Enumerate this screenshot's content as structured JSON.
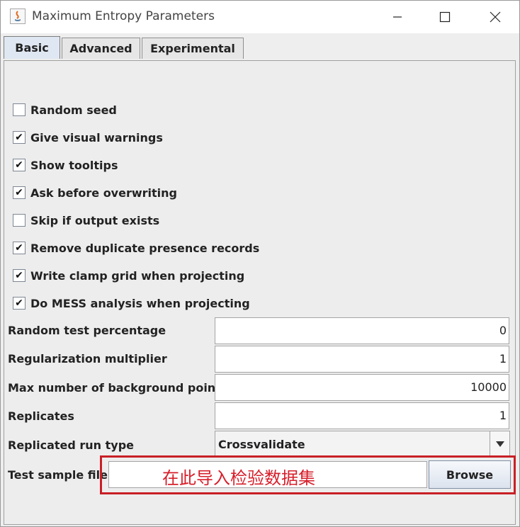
{
  "window": {
    "title": "Maximum Entropy Parameters"
  },
  "tabs": [
    {
      "label": "Basic",
      "active": true
    },
    {
      "label": "Advanced",
      "active": false
    },
    {
      "label": "Experimental",
      "active": false
    }
  ],
  "options": [
    {
      "label": "Random seed",
      "checked": false
    },
    {
      "label": "Give visual warnings",
      "checked": true
    },
    {
      "label": "Show tooltips",
      "checked": true
    },
    {
      "label": "Ask before overwriting",
      "checked": true
    },
    {
      "label": "Skip if output exists",
      "checked": false
    },
    {
      "label": "Remove duplicate presence records",
      "checked": true
    },
    {
      "label": "Write clamp grid when projecting",
      "checked": true
    },
    {
      "label": "Do MESS analysis when projecting",
      "checked": true
    }
  ],
  "fields": [
    {
      "label": "Random test percentage",
      "value": "0"
    },
    {
      "label": "Regularization multiplier",
      "value": "1"
    },
    {
      "label": "Max number of background points",
      "value": "10000"
    },
    {
      "label": "Replicates",
      "value": "1"
    }
  ],
  "run_type": {
    "label": "Replicated run type",
    "selected": "Crossvalidate"
  },
  "test_sample": {
    "label": "Test sample file",
    "value": "",
    "button": "Browse"
  },
  "annotation": {
    "text": "在此导入检验数据集",
    "color": "#d61f2b"
  },
  "icons": {
    "check": "✔",
    "dropdown": "▼"
  },
  "colors": {
    "active_tab": "#dfe7f2",
    "annotation_border": "#c81f26"
  }
}
